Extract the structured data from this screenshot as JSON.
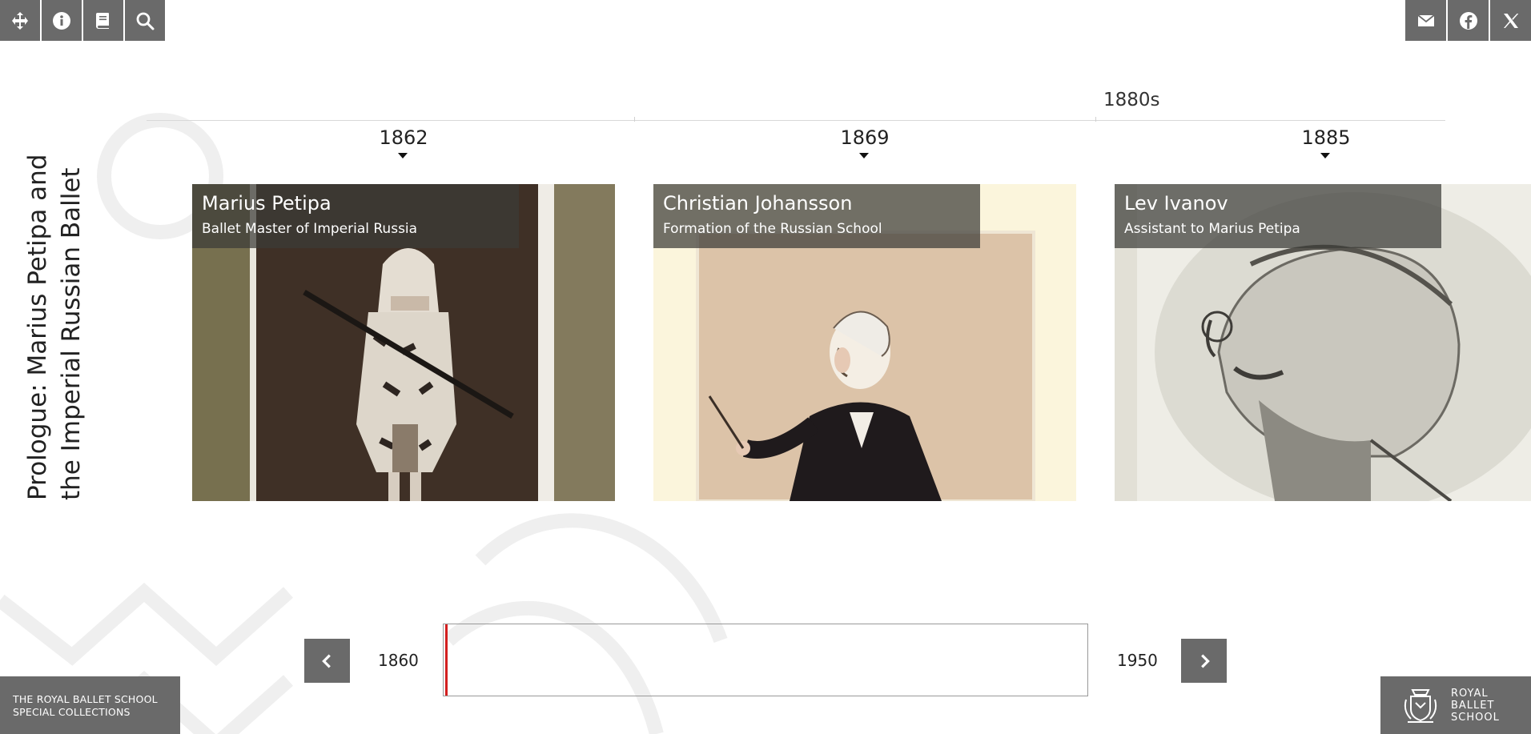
{
  "toolbar": {
    "left": [
      {
        "name": "move-icon"
      },
      {
        "name": "info-icon"
      },
      {
        "name": "book-icon"
      },
      {
        "name": "search-icon"
      }
    ],
    "right": [
      {
        "name": "email-icon"
      },
      {
        "name": "facebook-icon"
      },
      {
        "name": "x-twitter-icon"
      }
    ]
  },
  "section": {
    "title_line1": "Prologue: Marius Petipa and",
    "title_line2": "the Imperial Russian Ballet"
  },
  "timeline": {
    "decade_label": "1880s",
    "start_year": "1860",
    "end_year": "1950",
    "accent_color": "#d31f1f"
  },
  "entries": [
    {
      "year": "1862",
      "title": "Marius Petipa",
      "subtitle": "Ballet Master of Imperial Russia"
    },
    {
      "year": "1869",
      "title": "Christian Johansson",
      "subtitle": "Formation of the Russian School"
    },
    {
      "year": "1885",
      "title": "Lev Ivanov",
      "subtitle": "Assistant to Marius Petipa"
    }
  ],
  "footer": {
    "collection_line1": "THE ROYAL BALLET SCHOOL",
    "collection_line2": "SPECIAL COLLECTIONS",
    "logo_line1": "ROYAL",
    "logo_line2": "BALLET",
    "logo_line3": "SCHOOL"
  }
}
